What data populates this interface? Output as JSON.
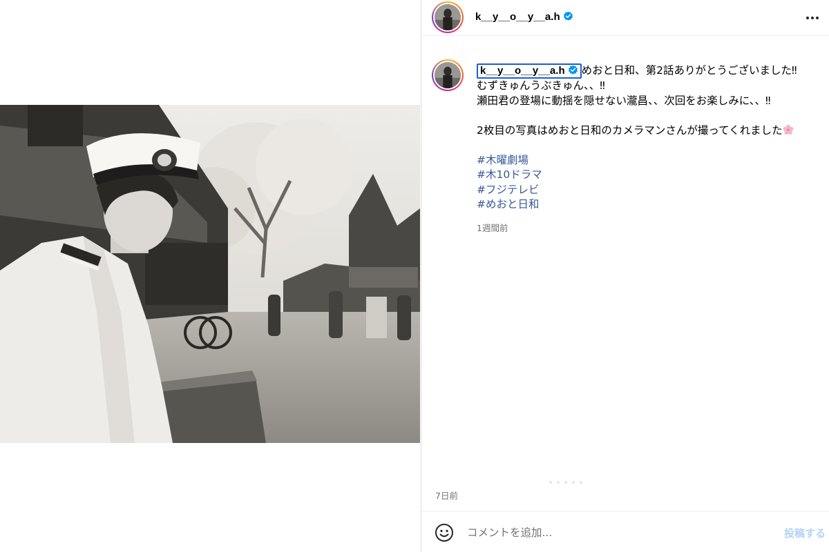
{
  "post": {
    "username": "k__y__o__y__a.h",
    "verified": true,
    "caption_lines": [
      "めおと日和、第2話ありがとうございました‼︎",
      "むずきゅんうぶきゅん、、‼︎",
      "瀬田君の登場に動揺を隠せない瀧昌、、次回をお楽しみに、、‼︎",
      "",
      "2枚目の写真はめおと日和のカメラマンさんが撮ってくれました"
    ],
    "hashtags": [
      "#木曜劇場",
      "#木10ドラマ",
      "#フジテレビ",
      "#めおと日和"
    ],
    "caption_time": "1週間前",
    "date": "7日前"
  },
  "comment": {
    "placeholder": "コメントを追加...",
    "post_label": "投稿する"
  },
  "icons": {
    "verified": "verified-badge-icon",
    "more": "more-options-icon",
    "emoji": "emoji-icon",
    "flower": "cherry-blossom-icon"
  },
  "colors": {
    "verified": "#0095f6",
    "hashtag": "#385898",
    "secondary_text": "#737373",
    "post_button_disabled": "#b3d3f7",
    "selection_box": "#1a5fd8"
  }
}
